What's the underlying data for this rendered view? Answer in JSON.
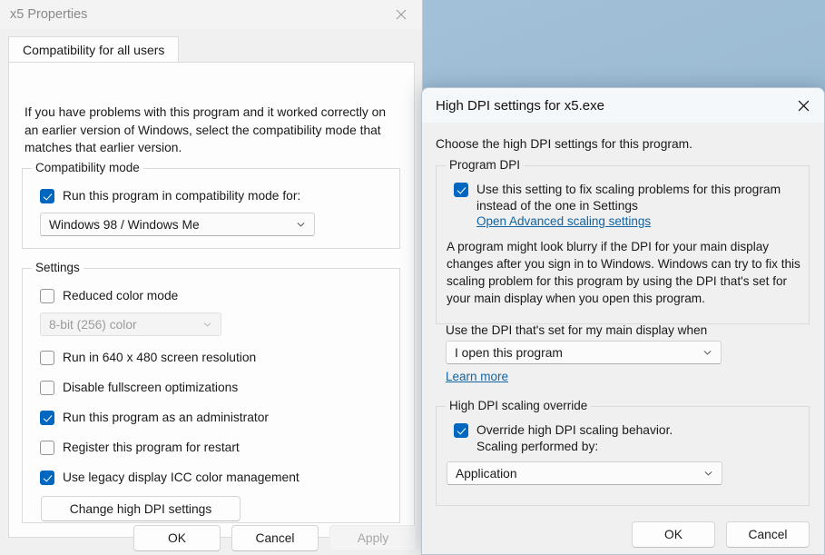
{
  "desktop": {
    "background_color": "#9cbcd4"
  },
  "properties_dialog": {
    "title": "x5 Properties",
    "close_icon": "close-icon",
    "tabs": [
      {
        "label": "Compatibility for all users",
        "active": true
      }
    ],
    "intro_text": "If you have problems with this program and it worked correctly on an earlier version of Windows, select the compatibility mode that matches that earlier version.",
    "compatibility_mode_group": {
      "legend": "Compatibility mode",
      "checkbox": {
        "label": "Run this program in compatibility mode for:",
        "checked": true
      },
      "dropdown": {
        "value": "Windows 98 / Windows Me",
        "enabled": true,
        "chevron_icon": "chevron-down-icon"
      }
    },
    "settings_group": {
      "legend": "Settings",
      "reduced_color_mode": {
        "label": "Reduced color mode",
        "checked": false
      },
      "color_depth_dropdown": {
        "value": "8-bit (256) color",
        "enabled": false,
        "chevron_icon": "chevron-down-icon"
      },
      "checkboxes": [
        {
          "label": "Run in 640 x 480 screen resolution",
          "checked": false
        },
        {
          "label": "Disable fullscreen optimizations",
          "checked": false
        },
        {
          "label": "Run this program as an administrator",
          "checked": true
        },
        {
          "label": "Register this program for restart",
          "checked": false
        },
        {
          "label": "Use legacy display ICC color management",
          "checked": true
        }
      ],
      "change_dpi_button": "Change high DPI settings"
    },
    "footer_buttons": {
      "ok": "OK",
      "cancel": "Cancel",
      "apply": "Apply",
      "apply_enabled": false
    }
  },
  "dpi_dialog": {
    "title": "High DPI settings for x5.exe",
    "close_icon": "close-icon",
    "intro_text": "Choose the high DPI settings for this program.",
    "program_dpi_group": {
      "legend": "Program DPI",
      "checkbox": {
        "label": "Use this setting to fix scaling problems for this program instead of the one in Settings",
        "checked": true
      },
      "advanced_link": "Open Advanced scaling settings",
      "description": "A program might look blurry if the DPI for your main display changes after you sign in to Windows. Windows can try to fix this scaling problem for this program by using the DPI that's set for your main display when you open this program.",
      "dpi_source_label": "Use the DPI that's set for my main display when",
      "dpi_source_dropdown": {
        "value": "I open this program",
        "chevron_icon": "chevron-down-icon"
      },
      "learn_more_link": "Learn more"
    },
    "scaling_override_group": {
      "legend": "High DPI scaling override",
      "checkbox": {
        "label_line1": "Override high DPI scaling behavior.",
        "label_line2": "Scaling performed by:",
        "checked": true
      },
      "dropdown": {
        "value": "Application",
        "chevron_icon": "chevron-down-icon"
      }
    },
    "footer_buttons": {
      "ok": "OK",
      "cancel": "Cancel"
    }
  },
  "theme": {
    "accent": "#0067c0",
    "link": "#1264a3",
    "window_bg": "#f0f0f0",
    "panel_bg": "#fdfdfd"
  }
}
